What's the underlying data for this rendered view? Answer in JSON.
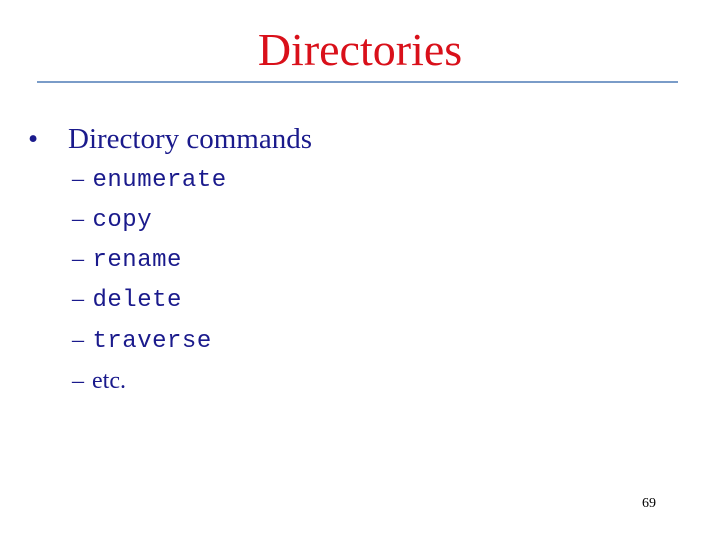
{
  "slide": {
    "title": "Directories",
    "bullet": {
      "marker": "•",
      "text": "Directory commands",
      "sub_items": [
        {
          "dash": "–",
          "text": "enumerate"
        },
        {
          "dash": "–",
          "text": "copy"
        },
        {
          "dash": "–",
          "text": "rename"
        },
        {
          "dash": "–",
          "text": "delete"
        },
        {
          "dash": "–",
          "text": "traverse"
        },
        {
          "dash": "–",
          "text": "etc."
        }
      ]
    },
    "page_number": "69"
  },
  "colors": {
    "title": "#d9101a",
    "body_text": "#1a1a8c",
    "rule": "#7a9cc8"
  }
}
